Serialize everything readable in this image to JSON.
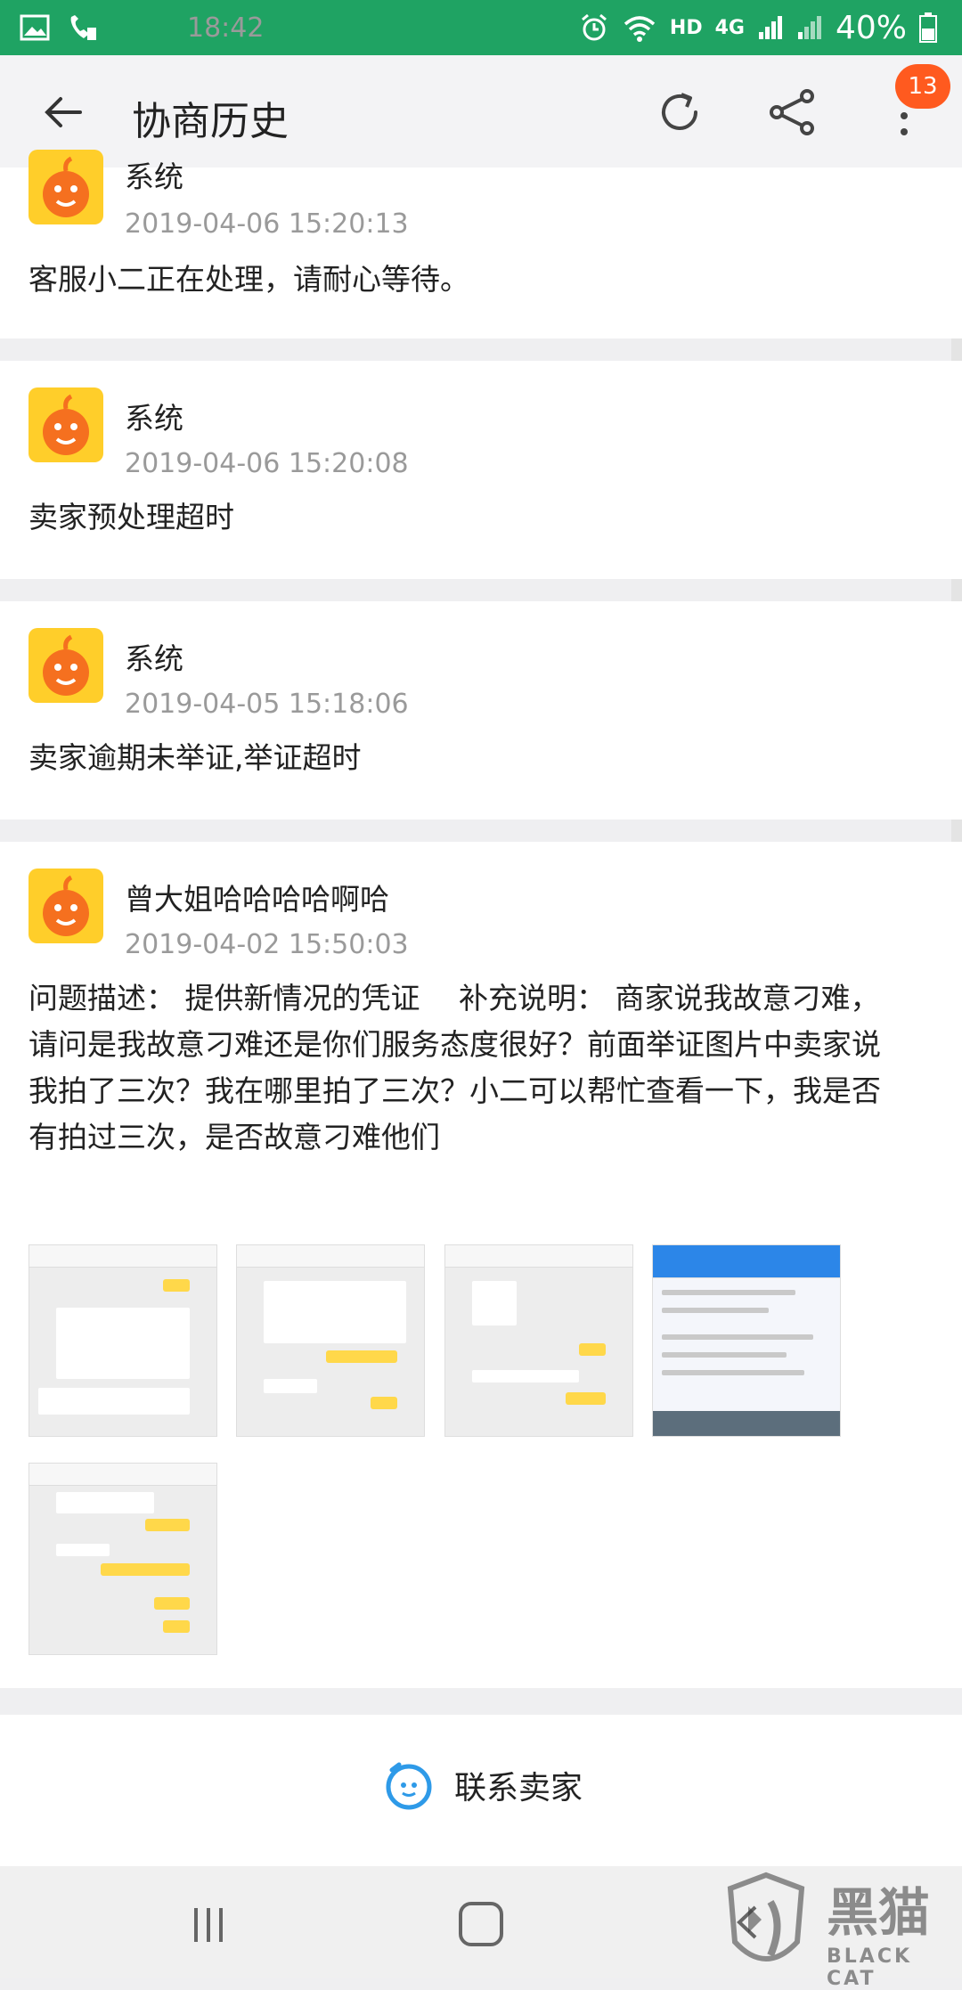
{
  "status_bar": {
    "time": "18:42",
    "network_hd": "HD",
    "network_4g": "4G",
    "battery": "40%"
  },
  "header": {
    "title": "协商历史",
    "badge_count": "13"
  },
  "records": [
    {
      "sender": "系统",
      "time": "2019-04-06 15:20:13",
      "message": "客服小二正在处理，请耐心等待。"
    },
    {
      "sender": "系统",
      "time": "2019-04-06 15:20:08",
      "message": "卖家预处理超时"
    },
    {
      "sender": "系统",
      "time": "2019-04-05 15:18:06",
      "message": "卖家逾期未举证,举证超时"
    },
    {
      "sender": "曾大姐哈哈哈哈啊哈",
      "time": "2019-04-02 15:50:03",
      "message_lines": [
        "问题描述： 提供新情况的凭证　 补充说明： 商家说我故意刁难，",
        "请问是我故意刁难还是你们服务态度很好？前面举证图片中卖家说",
        "我拍了三次？我在哪里拍了三次？小二可以帮忙查看一下，我是否",
        "有拍过三次，是否故意刁难他们"
      ]
    }
  ],
  "footer": {
    "contact_label": "联系卖家"
  },
  "watermark": {
    "cn": "黑猫",
    "en": "BLACK CAT"
  },
  "colors": {
    "status_bar": "#1fa363",
    "badge": "#ff5a1f",
    "avatar_bg": "#ffce2a",
    "contact_icon": "#2e9ae8"
  }
}
